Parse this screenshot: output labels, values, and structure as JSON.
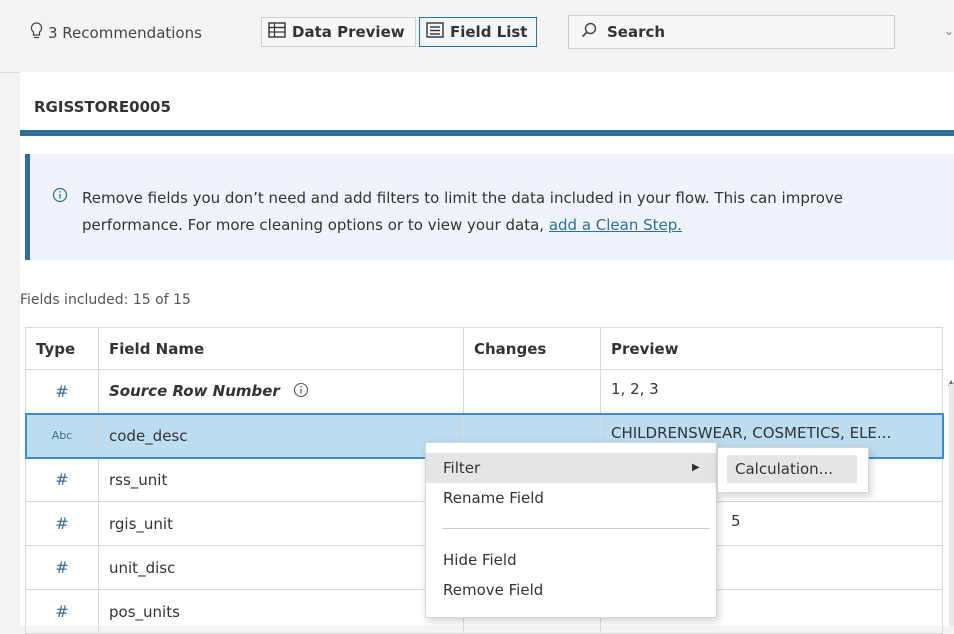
{
  "toolbar": {
    "recommendations": "3 Recommendations",
    "data_preview": "Data Preview",
    "field_list": "Field List",
    "search_placeholder": "Search"
  },
  "step": {
    "name": "RGISSTORE0005"
  },
  "info": {
    "text": "Remove fields you don’t need and add filters to limit the data included in your flow. This can improve performance. For more cleaning options or to view your data, ",
    "link": "add a Clean Step."
  },
  "fields_included": "Fields included: 15 of 15",
  "table": {
    "headers": [
      "Type",
      "Field Name",
      "Changes",
      "Preview"
    ],
    "rows": [
      {
        "type": "#",
        "name": "Source Row Number",
        "changes": "",
        "preview": "1, 2, 3"
      },
      {
        "type": "Abc",
        "name": "code_desc",
        "changes": "",
        "preview": "CHILDRENSWEAR, COSMETICS, ELE..."
      },
      {
        "type": "#",
        "name": "rss_unit",
        "changes": "",
        "preview": ""
      },
      {
        "type": "#",
        "name": "rgis_unit",
        "changes": "",
        "preview": "5"
      },
      {
        "type": "#",
        "name": "unit_disc",
        "changes": "",
        "preview": ""
      },
      {
        "type": "#",
        "name": "pos_units",
        "changes": "",
        "preview": ""
      }
    ]
  },
  "context_menu": {
    "items": [
      "Filter",
      "Rename Field",
      "Hide Field",
      "Remove Field"
    ],
    "submenu": [
      "Calculation..."
    ]
  },
  "colors": {
    "accent": "#2e6e99",
    "selected_row": "#bcdcf0",
    "type_icon": "#3d6d8f"
  }
}
